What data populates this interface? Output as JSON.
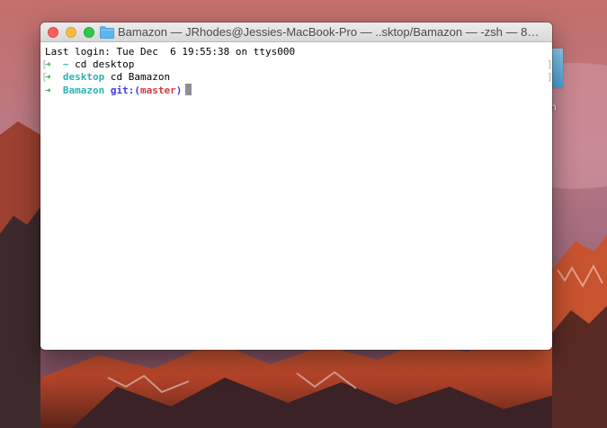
{
  "window": {
    "title": "Bamazon — JRhodes@Jessies-MacBook-Pro — ..sktop/Bamazon — -zsh — 8…"
  },
  "terminal": {
    "login_line": "Last login: Tue Dec  6 19:55:38 on ttys000",
    "lines": [
      {
        "prompt_arrow": "➜",
        "dir": "~",
        "command": "cd desktop"
      },
      {
        "prompt_arrow": "➜",
        "dir": "desktop",
        "command": "cd Bamazon"
      },
      {
        "prompt_arrow": "➜",
        "dir": "Bamazon",
        "git_label": "git:(",
        "branch": "master",
        "git_close": ")"
      }
    ]
  },
  "desktop": {
    "icon_label": "n"
  },
  "colors": {
    "close": "#fc605c",
    "minimize": "#fdbc40",
    "maximize": "#34c84a",
    "prompt_arrow": "#2fb145",
    "dir": "#2fb3b3",
    "git": "#3a3ae0",
    "branch": "#d23b3b"
  }
}
